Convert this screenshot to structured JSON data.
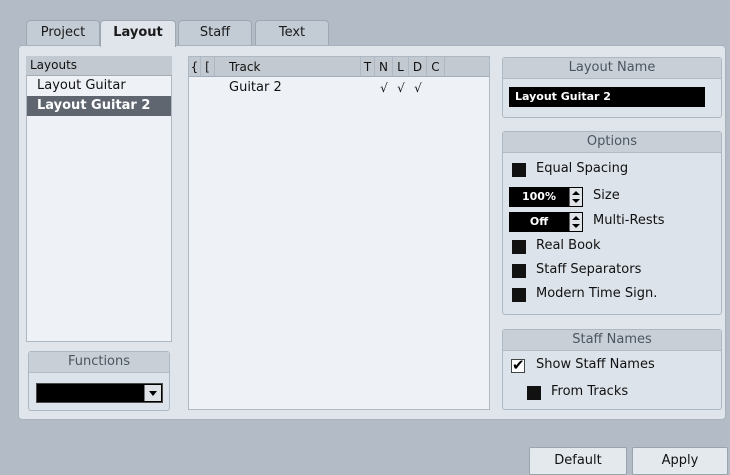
{
  "tabs": [
    {
      "label": "Project"
    },
    {
      "label": "Layout"
    },
    {
      "label": "Staff"
    },
    {
      "label": "Text"
    }
  ],
  "layouts": {
    "header": "Layouts",
    "items": [
      "Layout Guitar",
      "Layout Guitar 2"
    ]
  },
  "functions": {
    "header": "Functions",
    "value": ""
  },
  "track_table": {
    "headers": [
      "{",
      "[",
      "Track",
      "T",
      "N",
      "L",
      "D",
      "C"
    ],
    "rows": [
      {
        "track": "Guitar 2",
        "T": "",
        "N": "√",
        "L": "√",
        "D": "√",
        "C": ""
      }
    ]
  },
  "layout_name": {
    "header": "Layout Name",
    "value": "Layout Guitar 2"
  },
  "options": {
    "header": "Options",
    "equal_spacing": "Equal Spacing",
    "size_value": "100%",
    "size_label": "Size",
    "multirests_value": "Off",
    "multirests_label": "Multi-Rests",
    "real_book": "Real Book",
    "staff_separators": "Staff Separators",
    "modern_time_sign": "Modern Time Sign."
  },
  "staff_names": {
    "header": "Staff Names",
    "show_staff_names": "Show Staff Names",
    "from_tracks": "From Tracks"
  },
  "buttons": {
    "default": "Default",
    "apply": "Apply"
  }
}
